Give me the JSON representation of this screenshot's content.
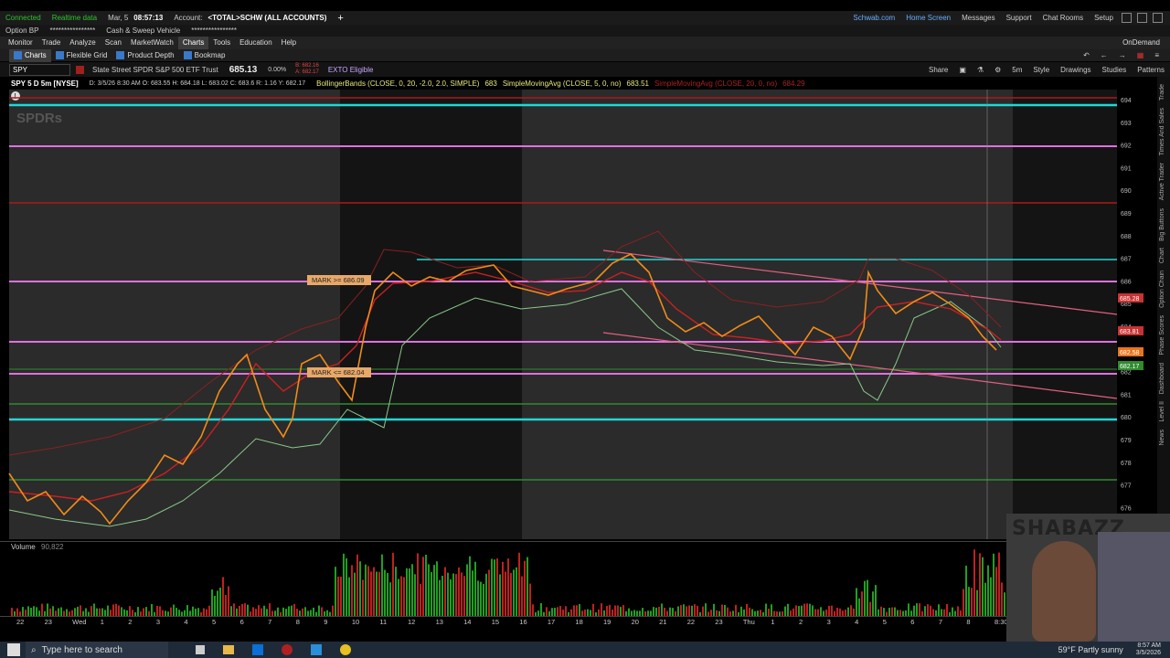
{
  "status": {
    "connected": "Connected",
    "realtime": "Realtime data",
    "date": "Mar, 5",
    "time": "08:57:13",
    "account_label": "Account:",
    "account": "<TOTAL>SCHW (ALL ACCOUNTS)",
    "links": [
      "Schwab.com",
      "Home Screen",
      "Messages",
      "Support",
      "Chat Rooms",
      "Setup"
    ]
  },
  "bp": {
    "option_bp": "Option BP",
    "option_bp_val": "****************",
    "cash_sweep": "Cash & Sweep Vehicle",
    "cash_sweep_val": "****************"
  },
  "nav": {
    "tabs": [
      "Monitor",
      "Trade",
      "Analyze",
      "Scan",
      "MarketWatch",
      "Charts",
      "Tools",
      "Education",
      "Help"
    ],
    "ondemand": "OnDemand"
  },
  "tools": {
    "items": [
      "Charts",
      "Flexible Grid",
      "Product Depth",
      "Bookmap"
    ]
  },
  "symbol": {
    "ticker": "SPY",
    "description": "State Street SPDR S&P 500 ETF Trust",
    "last": "685.13",
    "change_pct": "0.00%",
    "bid": "B: 682.16",
    "ask": "A: 682.17",
    "exto": "EXTO Eligible",
    "actions": [
      "Share",
      "Style",
      "Drawings",
      "Studies",
      "Patterns"
    ],
    "interval": "5m"
  },
  "study_line": {
    "title": "SPY 5 D 5m [NYSE]",
    "ohlc": "D: 3/5/26 8:30 AM  O: 683.55  H: 684.18  L: 683.02  C: 683.6  R: 1.16  Y: 682.17",
    "bb": "BollingerBands (CLOSE, 0, 20, -2.0, 2.0, SIMPLE)",
    "bb_val": "683",
    "sma5": "SimpleMovingAvg (CLOSE, 5, 0, no)",
    "sma5_val": "683.51",
    "sma20": "SimpleMovingAvg (CLOSE, 20, 0, no)",
    "sma20_val": "684.29"
  },
  "chart": {
    "watermark": "SPDRs",
    "y_ticks": [
      "694",
      "693",
      "692",
      "691",
      "690",
      "689",
      "688",
      "687",
      "686",
      "685",
      "684",
      "683",
      "682",
      "681",
      "680",
      "679",
      "678",
      "677",
      "676"
    ],
    "price_tags": [
      {
        "label": "685.28",
        "color": "#c83232"
      },
      {
        "label": "683.81",
        "color": "#c83232"
      },
      {
        "label": "682.58",
        "color": "#e8741e"
      },
      {
        "label": "682.17",
        "color": "#2e8b2e"
      }
    ],
    "marks": [
      "MARK >= 686.09",
      "MARK <= 682.04"
    ],
    "x_ticks": [
      "22",
      "23",
      "Wed",
      "1",
      "2",
      "3",
      "4",
      "5",
      "6",
      "7",
      "8",
      "9",
      "10",
      "11",
      "12",
      "13",
      "14",
      "15",
      "16",
      "17",
      "18",
      "19",
      "20",
      "21",
      "22",
      "23",
      "Thu",
      "1",
      "2",
      "3",
      "4",
      "5",
      "6",
      "7",
      "8",
      "8:30"
    ]
  },
  "volume": {
    "label": "Volume",
    "value": "90,822"
  },
  "sidebar": [
    "Trade",
    "Times And Sales",
    "Active Trader",
    "Big Buttons",
    "Chart",
    "Option Chain",
    "Phase Scores",
    "Dashboard",
    "Level II",
    "News"
  ],
  "taskbar": {
    "search_placeholder": "Type here to search",
    "weather": "59°F  Partly sunny",
    "clock": "8:57 AM",
    "date": "3/5/2026"
  },
  "webcam": {
    "banner": "SHABAZZ"
  }
}
